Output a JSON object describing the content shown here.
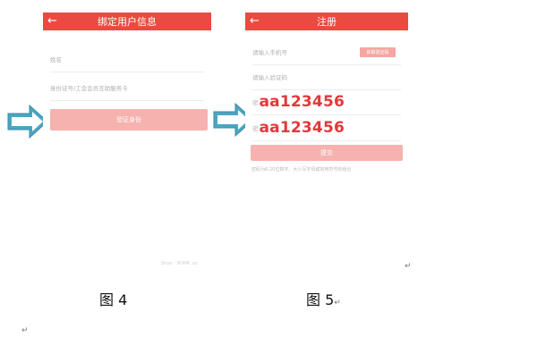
{
  "left_arrow": {
    "icon": "arrow-right-icon",
    "color": "#4ba6c2"
  },
  "right_arrow": {
    "icon": "arrow-right-icon",
    "color": "#4ba6c2"
  },
  "fig4": {
    "title": "绑定用户信息",
    "back_icon": "back-arrow-icon",
    "back_glyph": "←",
    "name_placeholder": "姓名",
    "id_placeholder": "身份证号/工会会员互助服务卡",
    "verify_button": "验证身份",
    "watermark": "Shun : WWM..so",
    "accent_color": "#ea4a3f"
  },
  "fig5": {
    "title": "注册",
    "back_icon": "back-arrow-icon",
    "back_glyph": "←",
    "phone_placeholder": "请输入手机号",
    "get_code_button": "获取验证码",
    "code_placeholder": "请输入验证码",
    "password_prefix": "密",
    "password_value": "aa123456",
    "confirm_prefix": "密",
    "confirm_value": "aa123456",
    "submit_button": "提交",
    "hint": "密码为6-20位数字、大小写字母或常用符号的组合"
  },
  "captions": {
    "fig4": "图 4",
    "fig5": "图 5"
  },
  "return_mark": "↵"
}
